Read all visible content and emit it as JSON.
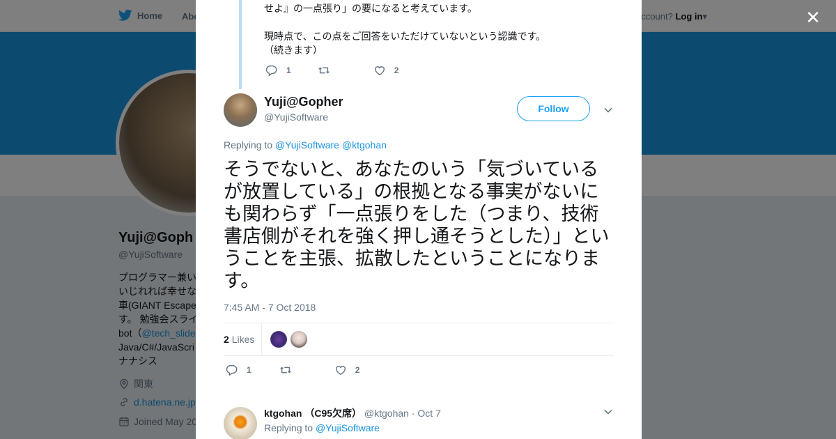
{
  "nav": {
    "home_label": "Home",
    "about_label": "Abo",
    "login_prompt": "account?",
    "login_label": "Log in"
  },
  "profile": {
    "name": "Yuji@Goph",
    "handle": "@YujiSoftware",
    "bio": [
      "プログラマー兼い",
      "いじれれば幸せな",
      "車(GIANT Escape",
      "す。 勉強会スライ",
      "bot（",
      "Java/C#/JavaScri",
      "ナナシス"
    ],
    "bio_link": "@tech_slide",
    "location": "関東",
    "website": "d.hatena.ne.jp",
    "joined": "Joined May 20"
  },
  "prev_tweet": {
    "line1": "せよ』の一点張り」の要になると考えています。",
    "line2": "現時点で、この点をご回答をいただけていないという認識です。",
    "line3": "（続きます）",
    "reply_count": "1",
    "like_count": "2"
  },
  "tweet": {
    "author_name": "Yuji@Gopher",
    "author_handle": "@YujiSoftware",
    "follow_label": "Follow",
    "replying_prefix": "Replying to",
    "replying_to_1": "@YujiSoftware",
    "replying_to_2": "@ktgohan",
    "text": "そうでないと、あなたのいう「気づいているが放置している」の根拠となる事実がないにも関わらず「一点張りをした（つまり、技術書店側がそれを強く押し通そうとした）」ということを主張、拡散したということになります。",
    "timestamp": "7:45 AM - 7 Oct 2018",
    "likes_number": "2",
    "likes_label": "Likes",
    "reply_count": "1",
    "like_count": "2"
  },
  "reply": {
    "author_name": "ktgohan （C95欠席）",
    "author_handle": "@ktgohan",
    "date": "· Oct 7",
    "replying_prefix": "Replying to",
    "replying_to": "@YujiSoftware"
  },
  "colors": {
    "accent": "#1da1f2",
    "banner": "#1b95e0",
    "thread_line": "#bbddf5",
    "muted": "#657786"
  }
}
